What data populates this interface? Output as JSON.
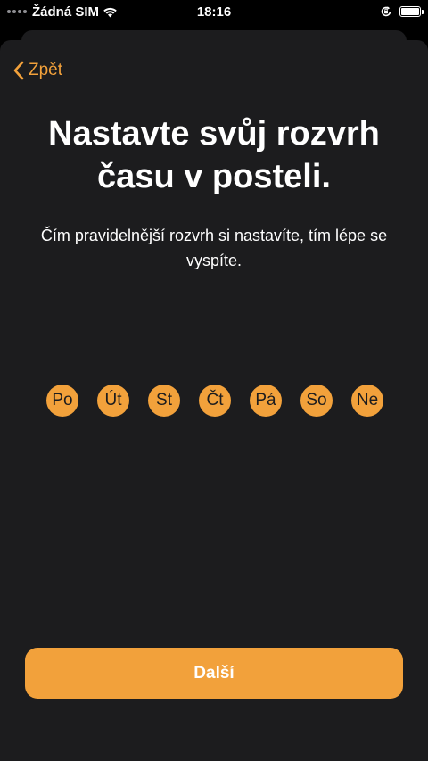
{
  "status_bar": {
    "carrier": "Žádná SIM",
    "time": "18:16",
    "icons": [
      "wifi-icon",
      "orientation-lock-icon",
      "battery-icon"
    ]
  },
  "nav": {
    "back_label": "Zpět",
    "back_icon": "chevron-left-icon"
  },
  "main": {
    "title": "Nastavte svůj rozvrh času v posteli.",
    "subtitle": "Čím pravidelnější rozvrh si nastavíte, tím lépe se vyspíte."
  },
  "days": [
    {
      "label": "Po",
      "selected": true
    },
    {
      "label": "Út",
      "selected": true
    },
    {
      "label": "St",
      "selected": true
    },
    {
      "label": "Čt",
      "selected": true
    },
    {
      "label": "Pá",
      "selected": true
    },
    {
      "label": "So",
      "selected": true
    },
    {
      "label": "Ne",
      "selected": true
    }
  ],
  "footer": {
    "next_label": "Další"
  },
  "colors": {
    "accent": "#f2a13b",
    "sheet_background": "#1c1c1e",
    "background": "#000000"
  }
}
